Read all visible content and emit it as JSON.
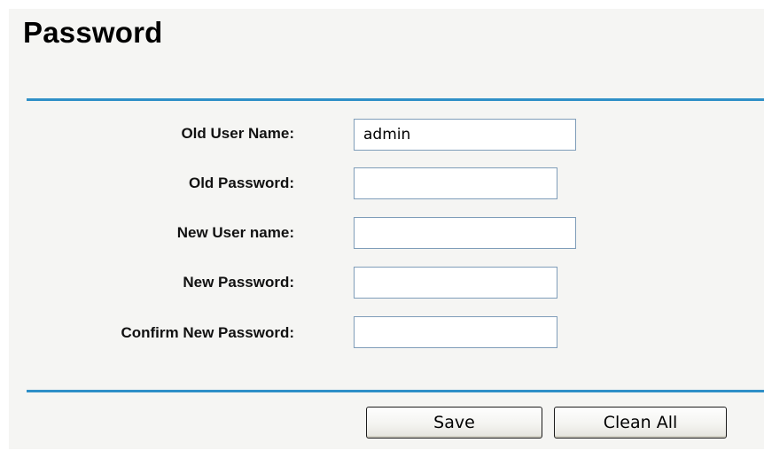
{
  "page": {
    "title": "Password"
  },
  "form": {
    "old_user_name": {
      "label": "Old User Name:",
      "value": "admin"
    },
    "old_password": {
      "label": "Old Password:",
      "value": ""
    },
    "new_user_name": {
      "label": "New User name:",
      "value": ""
    },
    "new_password": {
      "label": "New Password:",
      "value": ""
    },
    "confirm_new_password": {
      "label": "Confirm New Password:",
      "value": ""
    }
  },
  "buttons": {
    "save_label": "Save",
    "clean_all_label": "Clean All"
  },
  "colors": {
    "panel_background": "#f5f5f3",
    "divider": "#2f8fc7",
    "input_border": "#7f9db9"
  }
}
